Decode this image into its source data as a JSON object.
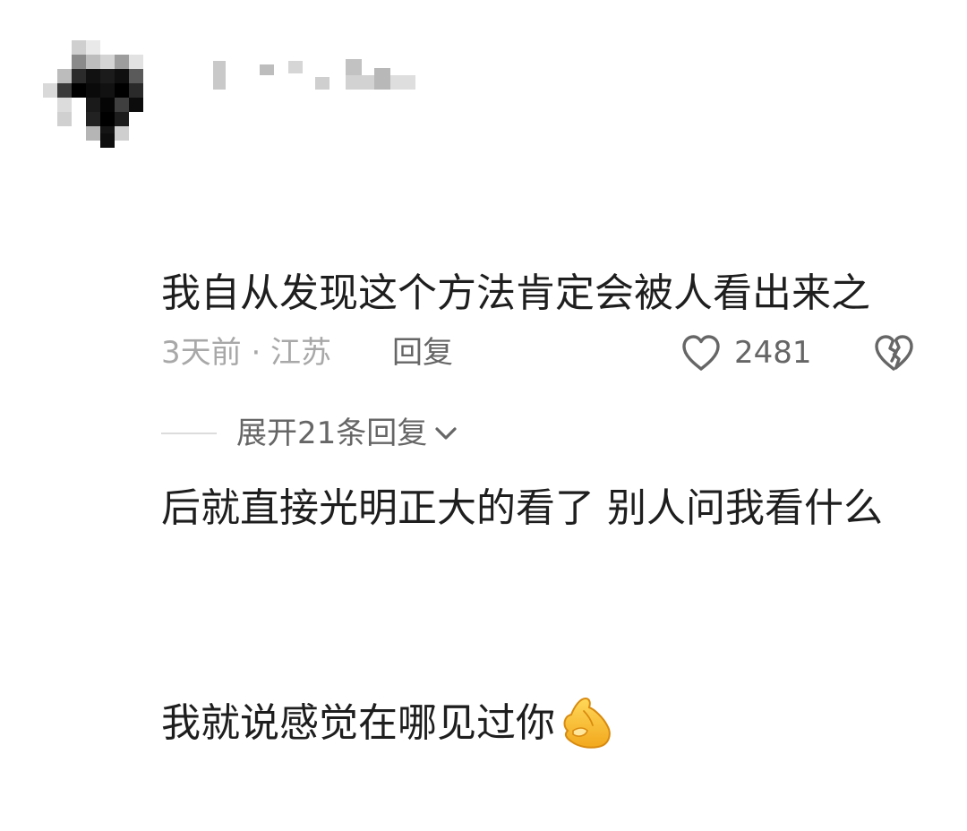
{
  "comment": {
    "lines": [
      "我自从发现这个方法肯定会被人看出来之",
      "后就直接光明正大的看了 别人问我看什么",
      "我就说感觉在哪见过你"
    ],
    "emoji": "pinched-fingers-emoji"
  },
  "meta": {
    "time_location": "3天前 · 江苏",
    "reply_label": "回复",
    "like_count": "2481"
  },
  "replies": {
    "expand_label": "展开21条回复"
  },
  "colors": {
    "text": "#1e1e1e",
    "meta": "#a8a8a8",
    "action": "#666666",
    "emoji": "#f7c531"
  }
}
